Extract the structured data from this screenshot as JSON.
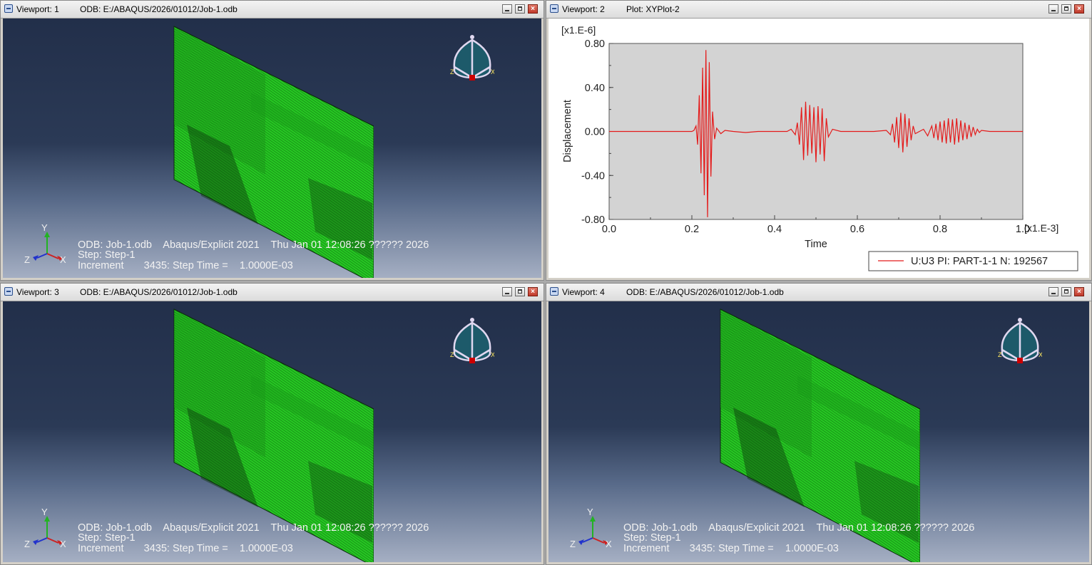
{
  "viewports": [
    {
      "title": "Viewport: 1",
      "subtitle": "ODB: E:/ABAQUS/2026/01012/Job-1.odb",
      "info": {
        "line1": "ODB: Job-1.odb    Abaqus/Explicit 2021    Thu Jan 01 12:08:26 ?????? 2026",
        "line2": "Step: Step-1",
        "line3": "Increment       3435: Step Time =    1.0000E-03"
      }
    },
    {
      "title": "Viewport: 2",
      "subtitle": "Plot: XYPlot-2"
    },
    {
      "title": "Viewport: 3",
      "subtitle": "ODB: E:/ABAQUS/2026/01012/Job-1.odb",
      "info": {
        "line1": "ODB: Job-1.odb    Abaqus/Explicit 2021    Thu Jan 01 12:08:26 ?????? 2026",
        "line2": "Step: Step-1",
        "line3": "Increment       3435: Step Time =    1.0000E-03"
      }
    },
    {
      "title": "Viewport: 4",
      "subtitle": "ODB: E:/ABAQUS/2026/01012/Job-1.odb",
      "info": {
        "line1": "ODB: Job-1.odb    Abaqus/Explicit 2021    Thu Jan 01 12:08:26 ?????? 2026",
        "line2": "Step: Step-1",
        "line3": "Increment       3435: Step Time =    1.0000E-03"
      }
    }
  ],
  "triad": {
    "x": "X",
    "y": "Y",
    "z": "Z"
  },
  "window_buttons": {
    "minimize": "minimize",
    "maximize": "maximize",
    "close": "×"
  },
  "colors": {
    "mesh": "#22c71f",
    "mesh_dark": "#0c3a0c",
    "viewport_top": "#222f4a",
    "viewport_bottom": "#a5afc3",
    "plot_bg": "#d3d3d3",
    "curve": "#e41a1a"
  },
  "icons": [
    "viewport-menu-icon",
    "minimize-icon",
    "maximize-icon",
    "close-icon",
    "view-cube-icon",
    "axis-triad-icon"
  ],
  "chart_data": {
    "type": "line",
    "xlabel": "Time",
    "ylabel": "Displacement",
    "x_multiplier": "[x1.E-3]",
    "y_multiplier": "[x1.E-6]",
    "xlim": [
      0.0,
      1.0
    ],
    "ylim": [
      -0.8,
      0.8
    ],
    "x_ticks": [
      "0.0",
      "0.2",
      "0.4",
      "0.6",
      "0.8",
      "1.0"
    ],
    "y_ticks": [
      "0.80",
      "0.40",
      "0.00",
      "-0.40",
      "-0.80"
    ],
    "grid": false,
    "legend": "U:U3 PI: PART-1-1 N: 192567",
    "legend_position": "bottom-right",
    "series": [
      {
        "name": "U:U3 PI: PART-1-1 N: 192567",
        "color": "#e41a1a",
        "x": [
          0.0,
          0.2,
          0.205,
          0.21,
          0.214,
          0.218,
          0.222,
          0.226,
          0.23,
          0.234,
          0.238,
          0.242,
          0.246,
          0.25,
          0.255,
          0.26,
          0.27,
          0.28,
          0.3,
          0.33,
          0.36,
          0.4,
          0.43,
          0.44,
          0.45,
          0.455,
          0.46,
          0.465,
          0.47,
          0.475,
          0.48,
          0.485,
          0.49,
          0.495,
          0.5,
          0.505,
          0.51,
          0.515,
          0.52,
          0.525,
          0.53,
          0.54,
          0.56,
          0.6,
          0.64,
          0.67,
          0.68,
          0.685,
          0.69,
          0.695,
          0.7,
          0.705,
          0.71,
          0.715,
          0.72,
          0.725,
          0.73,
          0.735,
          0.74,
          0.75,
          0.76,
          0.77,
          0.78,
          0.785,
          0.79,
          0.795,
          0.8,
          0.805,
          0.81,
          0.815,
          0.82,
          0.825,
          0.83,
          0.835,
          0.84,
          0.845,
          0.85,
          0.855,
          0.86,
          0.865,
          0.87,
          0.875,
          0.88,
          0.885,
          0.89,
          0.895,
          0.9,
          0.92,
          0.95,
          1.0
        ],
        "y": [
          0.0,
          0.0,
          0.01,
          0.05,
          -0.12,
          0.33,
          -0.38,
          0.58,
          -0.58,
          0.74,
          -0.78,
          0.63,
          -0.41,
          0.18,
          -0.07,
          0.03,
          -0.02,
          0.01,
          0.0,
          -0.01,
          0.0,
          0.0,
          0.0,
          0.02,
          -0.03,
          0.08,
          -0.12,
          0.22,
          -0.26,
          0.27,
          -0.22,
          0.24,
          -0.2,
          0.22,
          -0.28,
          0.23,
          -0.21,
          0.21,
          -0.27,
          0.12,
          -0.05,
          0.02,
          0.0,
          0.0,
          0.0,
          0.01,
          -0.03,
          0.07,
          -0.1,
          0.13,
          -0.15,
          0.17,
          -0.19,
          0.16,
          -0.14,
          0.12,
          -0.08,
          0.05,
          -0.02,
          0.0,
          0.02,
          -0.04,
          0.05,
          -0.06,
          0.07,
          -0.08,
          0.09,
          -0.1,
          0.1,
          -0.11,
          0.12,
          -0.1,
          0.11,
          -0.12,
          0.12,
          -0.1,
          0.1,
          -0.08,
          0.08,
          -0.07,
          0.06,
          -0.05,
          0.04,
          -0.03,
          0.02,
          -0.01,
          0.01,
          0.0,
          0.0,
          0.0
        ]
      }
    ]
  }
}
